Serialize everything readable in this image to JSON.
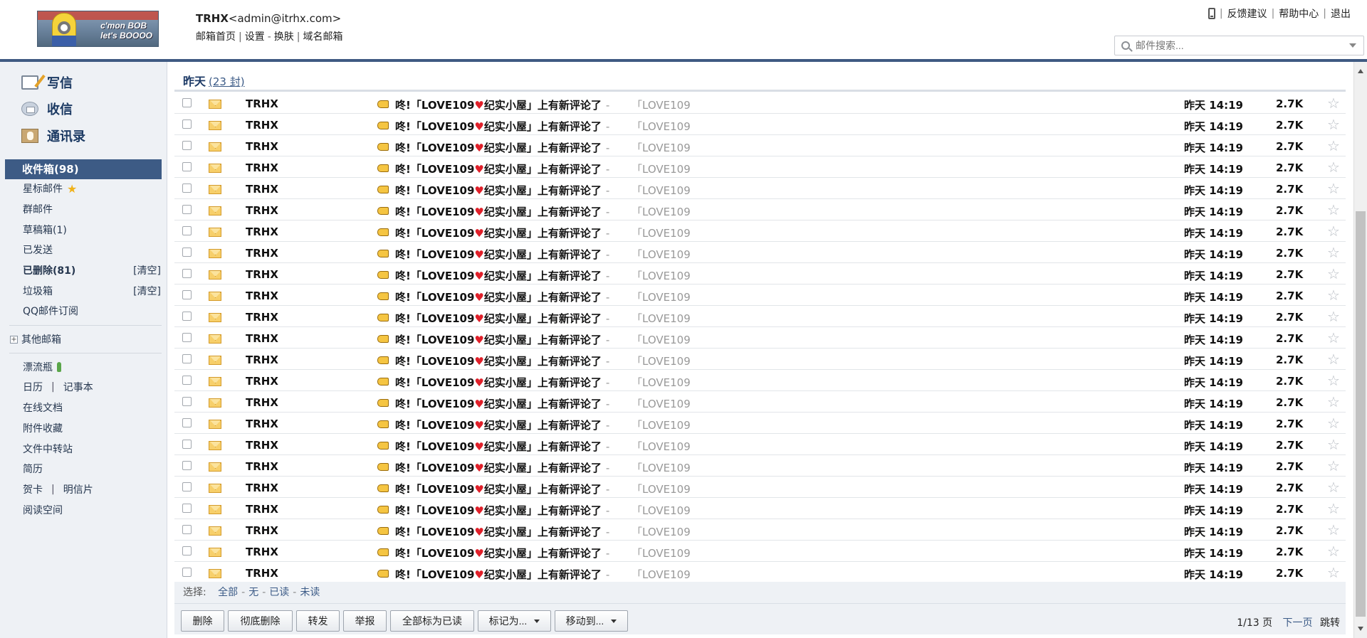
{
  "header": {
    "logo_text_line1": "c'mon BOB",
    "logo_text_line2": "let's BOOOO",
    "user_name": "TRHX",
    "user_email": "<admin@itrhx.com>",
    "links": [
      "邮箱首页",
      "设置",
      "换肤",
      "域名邮箱"
    ],
    "top_right": [
      "反馈建议",
      "帮助中心",
      "退出"
    ],
    "search_placeholder": "邮件搜索..."
  },
  "sidebar": {
    "compose": "写信",
    "receive": "收信",
    "contacts": "通讯录",
    "inbox": "收件箱(98)",
    "folders": {
      "starred": "星标邮件",
      "group": "群邮件",
      "drafts": "草稿箱(1)",
      "sent": "已发送",
      "deleted": "已删除(81)",
      "deleted_action": "[清空]",
      "spam": "垃圾箱",
      "spam_action": "[清空]",
      "subscription": "QQ邮件订阅"
    },
    "other_mailbox": "其他邮箱",
    "tools": {
      "bottle": "漂流瓶",
      "calendar": "日历",
      "notes": "记事本",
      "docs": "在线文档",
      "attachments": "附件收藏",
      "file_transfer": "文件中转站",
      "resume": "简历",
      "greeting_card": "贺卡",
      "postcard": "明信片",
      "reading": "阅读空间"
    }
  },
  "main": {
    "group_title": "昨天",
    "group_count": "(23 封)",
    "mails": [
      {
        "sender": "TRHX",
        "subject_prefix": "咚!「LOVE109",
        "subject_suffix": "纪实小屋」上有新评论了",
        "preview": "「LOVE109",
        "time": "昨天 14:19",
        "size": "2.7K"
      },
      {
        "sender": "TRHX",
        "subject_prefix": "咚!「LOVE109",
        "subject_suffix": "纪实小屋」上有新评论了",
        "preview": "「LOVE109",
        "time": "昨天 14:19",
        "size": "2.7K"
      },
      {
        "sender": "TRHX",
        "subject_prefix": "咚!「LOVE109",
        "subject_suffix": "纪实小屋」上有新评论了",
        "preview": "「LOVE109",
        "time": "昨天 14:19",
        "size": "2.7K"
      },
      {
        "sender": "TRHX",
        "subject_prefix": "咚!「LOVE109",
        "subject_suffix": "纪实小屋」上有新评论了",
        "preview": "「LOVE109",
        "time": "昨天 14:19",
        "size": "2.7K"
      },
      {
        "sender": "TRHX",
        "subject_prefix": "咚!「LOVE109",
        "subject_suffix": "纪实小屋」上有新评论了",
        "preview": "「LOVE109",
        "time": "昨天 14:19",
        "size": "2.7K"
      },
      {
        "sender": "TRHX",
        "subject_prefix": "咚!「LOVE109",
        "subject_suffix": "纪实小屋」上有新评论了",
        "preview": "「LOVE109",
        "time": "昨天 14:19",
        "size": "2.7K"
      },
      {
        "sender": "TRHX",
        "subject_prefix": "咚!「LOVE109",
        "subject_suffix": "纪实小屋」上有新评论了",
        "preview": "「LOVE109",
        "time": "昨天 14:19",
        "size": "2.7K"
      },
      {
        "sender": "TRHX",
        "subject_prefix": "咚!「LOVE109",
        "subject_suffix": "纪实小屋」上有新评论了",
        "preview": "「LOVE109",
        "time": "昨天 14:19",
        "size": "2.7K"
      },
      {
        "sender": "TRHX",
        "subject_prefix": "咚!「LOVE109",
        "subject_suffix": "纪实小屋」上有新评论了",
        "preview": "「LOVE109",
        "time": "昨天 14:19",
        "size": "2.7K"
      },
      {
        "sender": "TRHX",
        "subject_prefix": "咚!「LOVE109",
        "subject_suffix": "纪实小屋」上有新评论了",
        "preview": "「LOVE109",
        "time": "昨天 14:19",
        "size": "2.7K"
      },
      {
        "sender": "TRHX",
        "subject_prefix": "咚!「LOVE109",
        "subject_suffix": "纪实小屋」上有新评论了",
        "preview": "「LOVE109",
        "time": "昨天 14:19",
        "size": "2.7K"
      },
      {
        "sender": "TRHX",
        "subject_prefix": "咚!「LOVE109",
        "subject_suffix": "纪实小屋」上有新评论了",
        "preview": "「LOVE109",
        "time": "昨天 14:19",
        "size": "2.7K"
      },
      {
        "sender": "TRHX",
        "subject_prefix": "咚!「LOVE109",
        "subject_suffix": "纪实小屋」上有新评论了",
        "preview": "「LOVE109",
        "time": "昨天 14:19",
        "size": "2.7K"
      },
      {
        "sender": "TRHX",
        "subject_prefix": "咚!「LOVE109",
        "subject_suffix": "纪实小屋」上有新评论了",
        "preview": "「LOVE109",
        "time": "昨天 14:19",
        "size": "2.7K"
      },
      {
        "sender": "TRHX",
        "subject_prefix": "咚!「LOVE109",
        "subject_suffix": "纪实小屋」上有新评论了",
        "preview": "「LOVE109",
        "time": "昨天 14:19",
        "size": "2.7K"
      },
      {
        "sender": "TRHX",
        "subject_prefix": "咚!「LOVE109",
        "subject_suffix": "纪实小屋」上有新评论了",
        "preview": "「LOVE109",
        "time": "昨天 14:19",
        "size": "2.7K"
      },
      {
        "sender": "TRHX",
        "subject_prefix": "咚!「LOVE109",
        "subject_suffix": "纪实小屋」上有新评论了",
        "preview": "「LOVE109",
        "time": "昨天 14:19",
        "size": "2.7K"
      },
      {
        "sender": "TRHX",
        "subject_prefix": "咚!「LOVE109",
        "subject_suffix": "纪实小屋」上有新评论了",
        "preview": "「LOVE109",
        "time": "昨天 14:19",
        "size": "2.7K"
      },
      {
        "sender": "TRHX",
        "subject_prefix": "咚!「LOVE109",
        "subject_suffix": "纪实小屋」上有新评论了",
        "preview": "「LOVE109",
        "time": "昨天 14:19",
        "size": "2.7K"
      },
      {
        "sender": "TRHX",
        "subject_prefix": "咚!「LOVE109",
        "subject_suffix": "纪实小屋」上有新评论了",
        "preview": "「LOVE109",
        "time": "昨天 14:19",
        "size": "2.7K"
      },
      {
        "sender": "TRHX",
        "subject_prefix": "咚!「LOVE109",
        "subject_suffix": "纪实小屋」上有新评论了",
        "preview": "「LOVE109",
        "time": "昨天 14:19",
        "size": "2.7K"
      },
      {
        "sender": "TRHX",
        "subject_prefix": "咚!「LOVE109",
        "subject_suffix": "纪实小屋」上有新评论了",
        "preview": "「LOVE109",
        "time": "昨天 14:19",
        "size": "2.7K"
      },
      {
        "sender": "TRHX",
        "subject_prefix": "咚!「LOVE109",
        "subject_suffix": "纪实小屋」上有新评论了",
        "preview": "「LOVE109",
        "time": "昨天 14:19",
        "size": "2.7K"
      }
    ],
    "select_label": "选择:",
    "select_options": [
      "全部",
      "无",
      "已读",
      "未读"
    ],
    "buttons": {
      "delete": "删除",
      "delete_permanently": "彻底删除",
      "forward": "转发",
      "report": "举报",
      "mark_all_read": "全部标为已读",
      "mark_as": "标记为...",
      "move_to": "移动到..."
    },
    "pager": {
      "page_info": "1/13 页",
      "next": "下一页",
      "jump": "跳转"
    }
  },
  "colors": {
    "accent": "#3d5b85",
    "sidebar_bg": "#eef1f5",
    "heart": "#e0202a",
    "preview_text": "#999999"
  },
  "icons": [
    "phone-icon",
    "search-icon",
    "compose-icon",
    "inbox-icon",
    "contacts-icon",
    "star-icon",
    "bottle-icon",
    "envelope-icon",
    "pointing-hand-icon",
    "heart-icon"
  ]
}
